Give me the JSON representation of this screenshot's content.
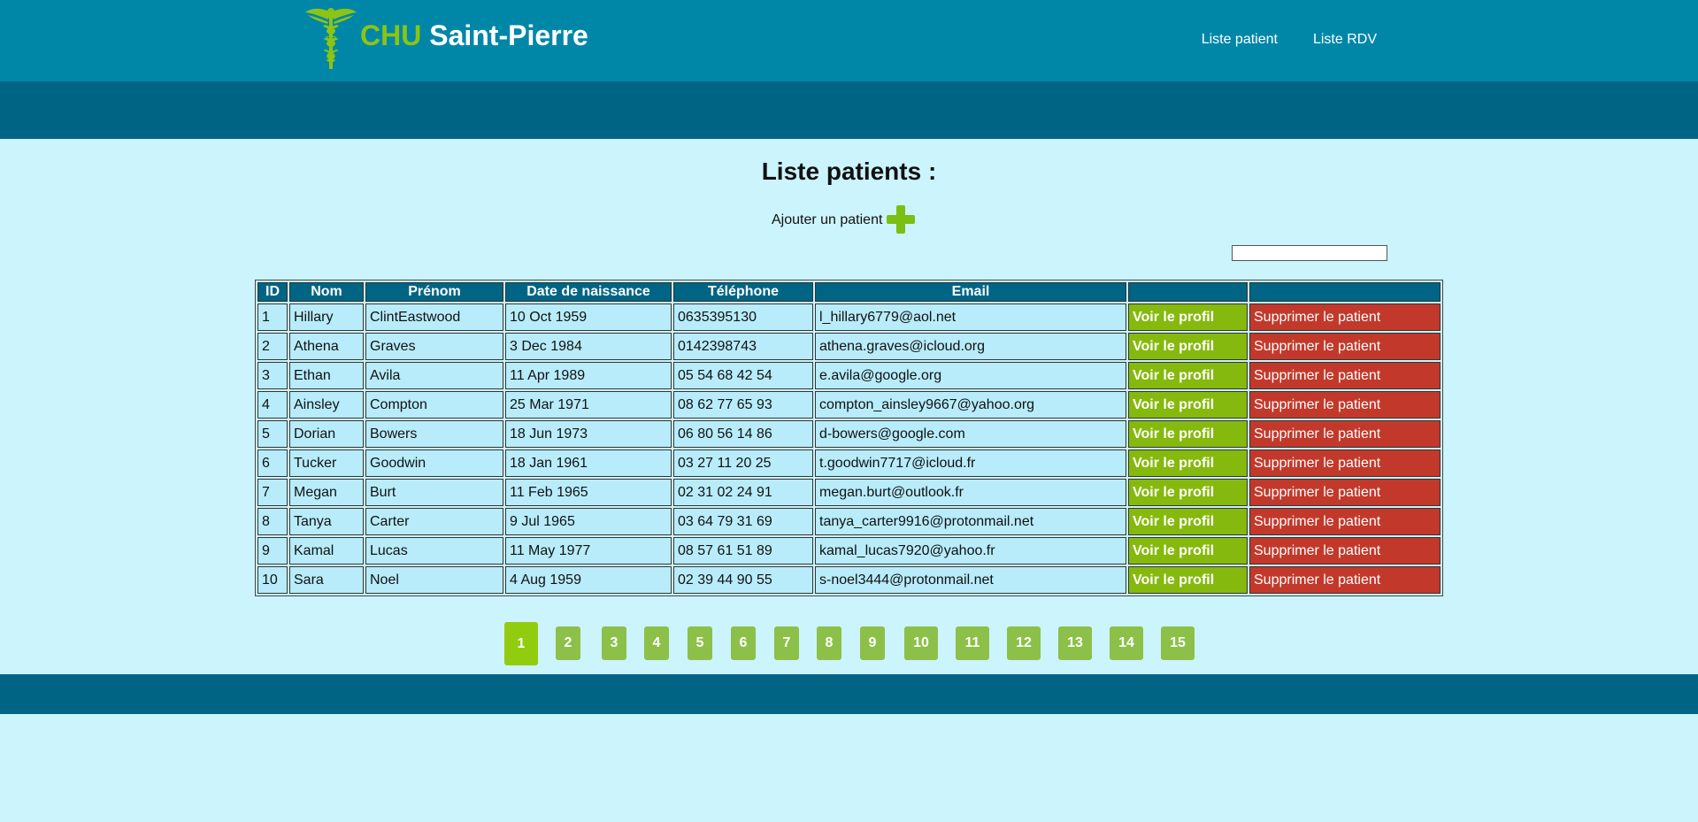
{
  "header": {
    "brand_part1": "CHU",
    "brand_part2": "Saint-Pierre",
    "logo_icon": "caduceus-icon",
    "nav": [
      "Liste patient",
      "Liste RDV"
    ]
  },
  "main": {
    "title": "Liste patients :",
    "add_label": "Ajouter un patient",
    "add_icon": "plus-icon",
    "search_value": ""
  },
  "table": {
    "headers": [
      "ID",
      "Nom",
      "Prénom",
      "Date de naissance",
      "Téléphone",
      "Email",
      "",
      ""
    ],
    "view_label": "Voir le profil",
    "delete_label": "Supprimer le patient",
    "rows": [
      [
        "1",
        "Hillary",
        "ClintEastwood",
        "10 Oct 1959",
        "0635395130",
        "l_hillary6779@aol.net"
      ],
      [
        "2",
        "Athena",
        "Graves",
        "3 Dec 1984",
        "0142398743",
        "athena.graves@icloud.org"
      ],
      [
        "3",
        "Ethan",
        "Avila",
        "11 Apr 1989",
        "05 54 68 42 54",
        "e.avila@google.org"
      ],
      [
        "4",
        "Ainsley",
        "Compton",
        "25 Mar 1971",
        "08 62 77 65 93",
        "compton_ainsley9667@yahoo.org"
      ],
      [
        "5",
        "Dorian",
        "Bowers",
        "18 Jun 1973",
        "06 80 56 14 86",
        "d-bowers@google.com"
      ],
      [
        "6",
        "Tucker",
        "Goodwin",
        "18 Jan 1961",
        "03 27 11 20 25",
        "t.goodwin7717@icloud.fr"
      ],
      [
        "7",
        "Megan",
        "Burt",
        "11 Feb 1965",
        "02 31 02 24 91",
        "megan.burt@outlook.fr"
      ],
      [
        "8",
        "Tanya",
        "Carter",
        "9 Jul 1965",
        "03 64 79 31 69",
        "tanya_carter9916@protonmail.net"
      ],
      [
        "9",
        "Kamal",
        "Lucas",
        "11 May 1977",
        "08 57 61 51 89",
        "kamal_lucas7920@yahoo.fr"
      ],
      [
        "10",
        "Sara",
        "Noel",
        "4 Aug 1959",
        "02 39 44 90 55",
        "s-noel3444@protonmail.net"
      ]
    ]
  },
  "pagination": {
    "current": "1",
    "pages": [
      "1",
      "2",
      "3",
      "4",
      "5",
      "6",
      "7",
      "8",
      "9",
      "10",
      "11",
      "12",
      "13",
      "14",
      "15"
    ]
  },
  "colors": {
    "header": "#0087a8",
    "subbar": "#006584",
    "background": "#ccf4fd",
    "brand_green": "#8cc414",
    "view_button": "#86b90e",
    "delete_button": "#c2392b"
  }
}
